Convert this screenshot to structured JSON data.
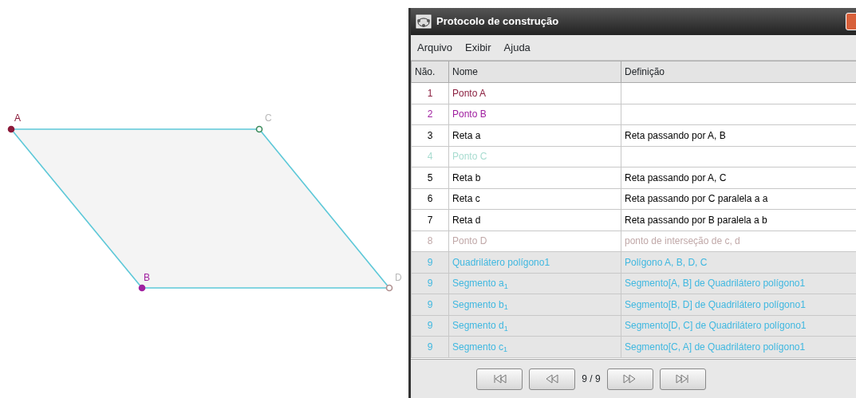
{
  "canvas": {
    "points": [
      {
        "label": "A",
        "color": "#8b1a3a",
        "filled": true
      },
      {
        "label": "C",
        "color": "#3a8a5a",
        "filled": false
      },
      {
        "label": "B",
        "color": "#a020a0",
        "filled": true
      },
      {
        "label": "D",
        "color": "#b09090",
        "filled": false
      }
    ]
  },
  "window": {
    "title": "Protocolo de construção"
  },
  "menu": [
    "Arquivo",
    "Exibir",
    "Ajuda"
  ],
  "table": {
    "columns": [
      "Não.",
      "Nome",
      "Definição"
    ],
    "rows": [
      {
        "number": "1",
        "name": "Ponto A",
        "definition": "",
        "color": "#8b2040",
        "selected": false
      },
      {
        "number": "2",
        "name": "Ponto B",
        "definition": "",
        "color": "#a020a0",
        "selected": false
      },
      {
        "number": "3",
        "name": "Reta a",
        "definition": "Reta passando por A, B",
        "color": "#000000",
        "selected": false
      },
      {
        "number": "4",
        "name": "Ponto C",
        "definition": "",
        "color": "#a8dcd0",
        "selected": false
      },
      {
        "number": "5",
        "name": "Reta b",
        "definition": "Reta passando por A, C",
        "color": "#000000",
        "selected": false
      },
      {
        "number": "6",
        "name": "Reta c",
        "definition": "Reta passando por C paralela a a",
        "color": "#000000",
        "selected": false
      },
      {
        "number": "7",
        "name": "Reta d",
        "definition": "Reta passando por B paralela a b",
        "color": "#000000",
        "selected": false
      },
      {
        "number": "8",
        "name": "Ponto D",
        "definition": "ponto de interseção de c, d",
        "color": "#c0a8a8",
        "selected": false
      },
      {
        "number": "9",
        "name": "Quadrilátero polígono1",
        "definition": "Polígono A, B, D, C",
        "color": "#40b8e0",
        "selected": true
      },
      {
        "number": "9",
        "name": "Segmento a$_{1}$",
        "definition": "Segmento[A, B] de Quadrilátero polígono1",
        "color": "#40b8e0",
        "selected": true
      },
      {
        "number": "9",
        "name": "Segmento b$_{1}$",
        "definition": "Segmento[B, D] de Quadrilátero polígono1",
        "color": "#40b8e0",
        "selected": true
      },
      {
        "number": "9",
        "name": "Segmento d$_{1}$",
        "definition": "Segmento[D, C] de Quadrilátero polígono1",
        "color": "#40b8e0",
        "selected": true
      },
      {
        "number": "9",
        "name": "Segmento c$_{1}$",
        "definition": "Segmento[C, A] de Quadrilátero polígono1",
        "color": "#40b8e0",
        "selected": true
      }
    ]
  },
  "navigation": {
    "buttons": [
      {
        "kind": "first"
      },
      {
        "kind": "previous"
      },
      {
        "kind": "next"
      },
      {
        "kind": "last"
      }
    ],
    "position": "9 / 9"
  }
}
